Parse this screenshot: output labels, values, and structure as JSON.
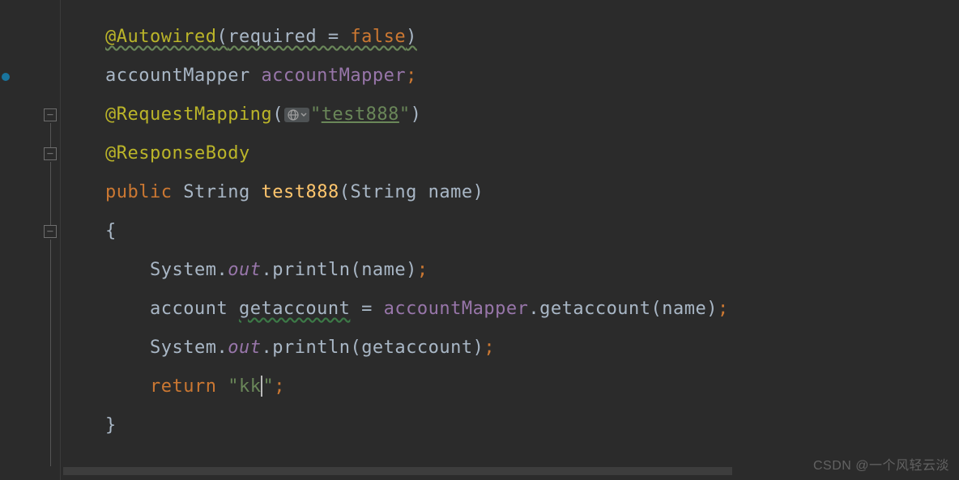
{
  "code": {
    "line1": {
      "anno_at": "@Autowired",
      "paren_open": "(",
      "param": "required",
      "eq": " = ",
      "val": "false",
      "paren_close": ")"
    },
    "line2": {
      "type": "accountMapper ",
      "var": "accountMapper",
      "semi": ";"
    },
    "line3": {
      "anno_at": "@RequestMapping",
      "paren_open": "(",
      "icon_name": "globe-icon",
      "str_open": "\"",
      "str_val": "test888",
      "str_close": "\"",
      "paren_close": ")"
    },
    "line4": {
      "anno_at": "@ResponseBody"
    },
    "line5": {
      "kw_public": "public",
      "sp1": " ",
      "type_string": "String",
      "sp2": " ",
      "method": "test888",
      "paren_open": "(",
      "ptype": "String",
      "sp3": " ",
      "pname": "name",
      "paren_close": ")"
    },
    "line6": {
      "brace": "{"
    },
    "line7": {
      "indent": "    ",
      "cls": "System",
      "dot1": ".",
      "field": "out",
      "dot2": ".",
      "println": "println",
      "paren_open": "(",
      "arg": "name",
      "paren_close": ")",
      "semi": ";"
    },
    "line8": {
      "indent": "    ",
      "type": "account ",
      "var": "getaccount",
      "eq": " = ",
      "mapper": "accountMapper",
      "dot": ".",
      "call": "getaccount",
      "paren_open": "(",
      "arg": "name",
      "paren_close": ")",
      "semi": ";"
    },
    "line9": {
      "indent": "    ",
      "cls": "System",
      "dot1": ".",
      "field": "out",
      "dot2": ".",
      "println": "println",
      "paren_open": "(",
      "arg": "getaccount",
      "paren_close": ")",
      "semi": ";"
    },
    "line10": {
      "indent": "    ",
      "kw_return": "return",
      "sp": " ",
      "str_open": "\"",
      "str_val": "kk",
      "str_close": "\"",
      "semi": ";"
    },
    "line11": {
      "brace": "}"
    }
  },
  "watermark": "CSDN @一个风轻云淡"
}
